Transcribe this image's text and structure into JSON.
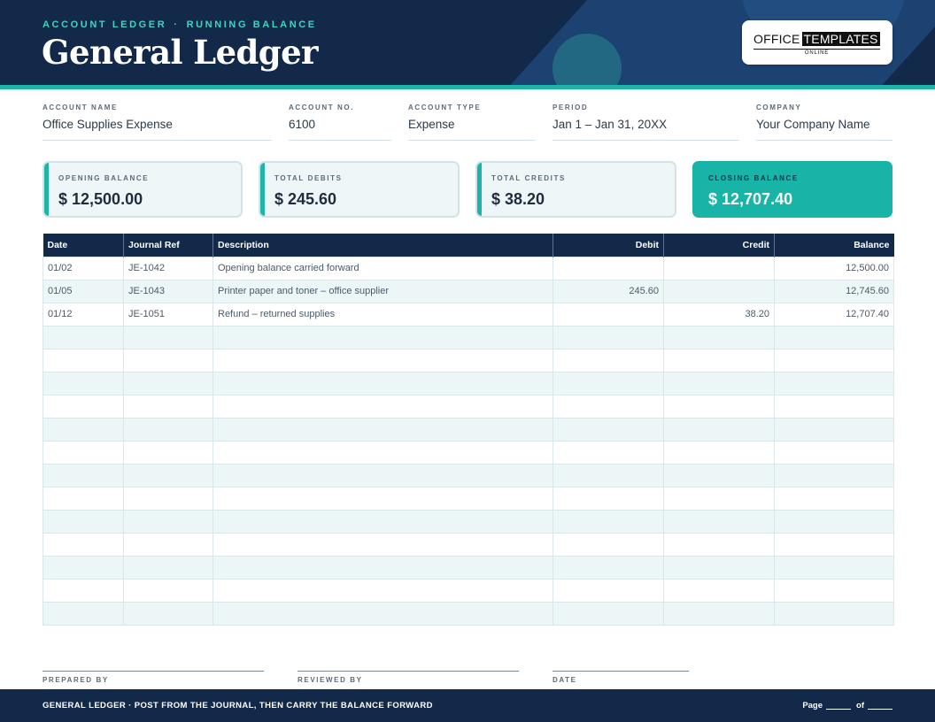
{
  "header": {
    "eyebrow_left": "ACCOUNT LEDGER",
    "eyebrow_sep": "·",
    "eyebrow_right": "RUNNING BALANCE",
    "title": "General Ledger"
  },
  "logo": {
    "word1": "OFFICE",
    "word2": "TEMPLATES",
    "word3": "ONLINE"
  },
  "account": {
    "name_label": "ACCOUNT NAME",
    "name_value": "Office Supplies Expense",
    "number_label": "ACCOUNT NO.",
    "number_value": "6100",
    "type_label": "ACCOUNT TYPE",
    "type_value": "Expense",
    "period_label": "PERIOD",
    "period_value": "Jan 1 – Jan 31, 20XX",
    "company_label": "COMPANY",
    "company_value": "Your Company Name"
  },
  "summary": [
    {
      "label": "OPENING BALANCE",
      "value": "$ 12,500.00"
    },
    {
      "label": "TOTAL DEBITS",
      "value": "$ 245.60"
    },
    {
      "label": "TOTAL CREDITS",
      "value": "$ 38.20"
    },
    {
      "label": "CLOSING BALANCE",
      "value": "$ 12,707.40"
    }
  ],
  "table": {
    "headers": [
      "Date",
      "Journal Ref",
      "Description",
      "Debit",
      "Credit",
      "Balance"
    ],
    "rows": [
      [
        "01/02",
        "JE-1042",
        "Opening balance carried forward",
        "",
        "",
        "12,500.00"
      ],
      [
        "01/05",
        "JE-1043",
        "Printer paper and toner – office supplier",
        "245.60",
        "",
        "12,745.60"
      ],
      [
        "01/12",
        "JE-1051",
        "Refund – returned supplies",
        "",
        "38.20",
        "12,707.40"
      ]
    ],
    "blank_rows": 13
  },
  "signatures": {
    "prepared": "PREPARED BY",
    "reviewed": "REVIEWED BY",
    "date": "DATE"
  },
  "footer": {
    "text": "GENERAL LEDGER  ·  POST FROM THE JOURNAL, THEN CARRY THE BALANCE FORWARD",
    "page_label": "Page",
    "of_label": "of"
  },
  "colors": {
    "navy": "#13294a",
    "teal": "#1fb5a6",
    "row_tint": "#ecf6f6"
  }
}
